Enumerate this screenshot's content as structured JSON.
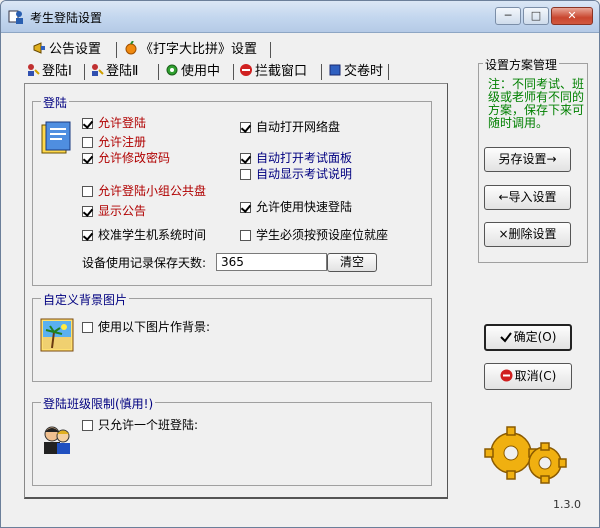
{
  "window": {
    "title": "考生登陆设置",
    "min_glyph": "─",
    "max_glyph": "□",
    "close_glyph": "✕"
  },
  "tabs_top": [
    {
      "label": "公告设置"
    },
    {
      "label": "《打字大比拼》设置"
    }
  ],
  "tabs_bottom": [
    {
      "label": "登陆Ⅰ",
      "active": true
    },
    {
      "label": "登陆Ⅱ"
    },
    {
      "label": "使用中"
    },
    {
      "label": "拦截窗口"
    },
    {
      "label": "交卷时"
    }
  ],
  "login_group": {
    "title": "登陆",
    "options": [
      {
        "label": "允许登陆",
        "checked": true,
        "color": "#b00000"
      },
      {
        "label": "允许注册",
        "checked": false,
        "color": "#b00000"
      },
      {
        "label": "允许修改密码",
        "checked": true,
        "color": "#b00000"
      },
      {
        "label": "允许登陆小组公共盘",
        "checked": false,
        "color": "#b00000"
      },
      {
        "label": "显示公告",
        "checked": true,
        "color": "#b00000"
      },
      {
        "label": "校准学生机系统时间",
        "checked": true,
        "color": "#000000"
      },
      {
        "label": "自动打开网络盘",
        "checked": true,
        "color": "#000000"
      },
      {
        "label": "自动打开考试面板",
        "checked": true,
        "color": "#000080"
      },
      {
        "label": "自动显示考试说明",
        "checked": false,
        "color": "#000080"
      },
      {
        "label": "允许使用快速登陆",
        "checked": true,
        "color": "#000000"
      },
      {
        "label": "学生必须按预设座位就座",
        "checked": false,
        "color": "#000000"
      }
    ],
    "days_label": "设备使用记录保存天数:",
    "days_value": "365",
    "clear_label": "清空"
  },
  "background_group": {
    "title": "自定义背景图片",
    "option": {
      "label": "使用以下图片作背景:",
      "checked": false
    }
  },
  "class_group": {
    "title": "登陆班级限制(慎用!)",
    "option": {
      "label": "只允许一个班登陆:",
      "checked": false
    }
  },
  "scheme": {
    "title": "设置方案管理",
    "note": "注：不同考试、班级或老师有不同的方案，保存下来可随时调用。",
    "save_label": "另存设置→",
    "import_label": "←导入设置",
    "delete_label": "×删除设置"
  },
  "ok_label": "确定(O)",
  "cancel_label": "取消(C)",
  "version": "1.3.0"
}
